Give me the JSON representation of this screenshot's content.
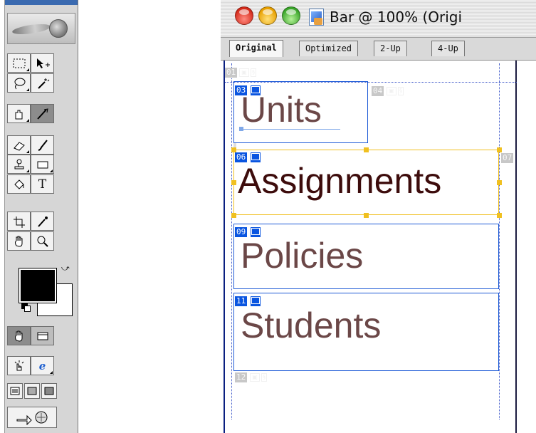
{
  "window": {
    "title": "Bar @ 100% (Origi",
    "tabs": [
      {
        "label": "Original",
        "active": true
      },
      {
        "label": "Optimized",
        "active": false
      },
      {
        "label": "2-Up",
        "active": false
      },
      {
        "label": "4-Up",
        "active": false
      }
    ]
  },
  "slices": [
    {
      "num": "01",
      "kind": "auto"
    },
    {
      "num": "03",
      "kind": "user",
      "text": "Units"
    },
    {
      "num": "04",
      "kind": "auto"
    },
    {
      "num": "06",
      "kind": "user",
      "text": "Assignments",
      "selected": true
    },
    {
      "num": "07",
      "kind": "auto"
    },
    {
      "num": "09",
      "kind": "user",
      "text": "Policies"
    },
    {
      "num": "11",
      "kind": "user",
      "text": "Students"
    },
    {
      "num": "12",
      "kind": "auto"
    }
  ],
  "palette": {
    "tools": [
      "marquee-tool",
      "move-tool",
      "lasso-tool",
      "magic-wand-tool",
      "slice-tool",
      "slice-select-tool",
      "eraser-tool",
      "brush-tool",
      "stamp-tool",
      "rectangle-tool",
      "paint-bucket-tool",
      "type-tool",
      "crop-tool",
      "eyedropper-tool",
      "hand-tool",
      "zoom-tool"
    ],
    "tool_text": "T",
    "foreground_color": "#000000",
    "background_color": "#ffffff"
  },
  "colors": {
    "slice_user": "#0a55e0",
    "slice_auto": "#c8c8c8",
    "slice_selected": "#f0c020",
    "text_dark": "#3d0c0c",
    "text_muted": "#6b4747"
  }
}
